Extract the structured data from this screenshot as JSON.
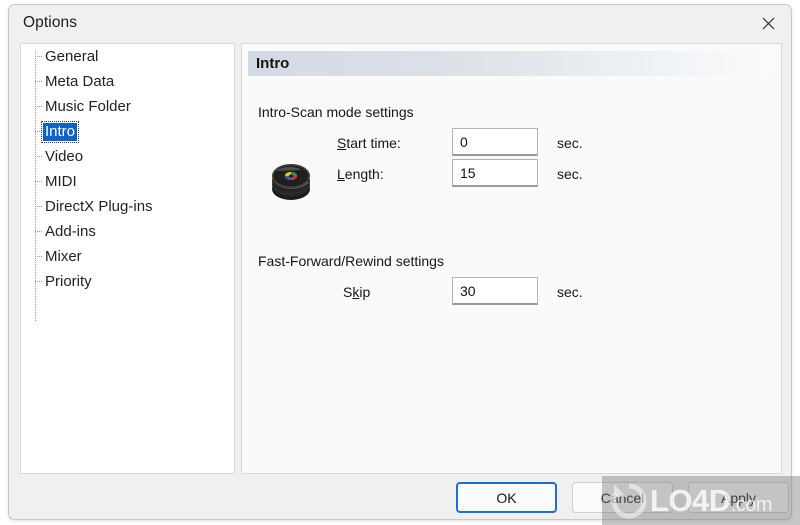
{
  "window": {
    "title": "Options",
    "close_icon": "close-icon"
  },
  "sidebar": {
    "items": [
      {
        "label": "General",
        "selected": false
      },
      {
        "label": "Meta Data",
        "selected": false
      },
      {
        "label": "Music Folder",
        "selected": false
      },
      {
        "label": "Intro",
        "selected": true
      },
      {
        "label": "Video",
        "selected": false
      },
      {
        "label": "MIDI",
        "selected": false
      },
      {
        "label": "DirectX Plug-ins",
        "selected": false
      },
      {
        "label": "Add-ins",
        "selected": false
      },
      {
        "label": "Mixer",
        "selected": false
      },
      {
        "label": "Priority",
        "selected": false
      }
    ],
    "selection_color": "#0f62c8"
  },
  "content": {
    "header": "Intro",
    "icon": "cd-stack-icon",
    "groups": [
      {
        "title": "Intro-Scan mode settings",
        "fields": [
          {
            "label_pre": "S",
            "label_accel": "",
            "label": "Start time:",
            "accel": "S",
            "value": "0",
            "unit": "sec."
          },
          {
            "label": "Length:",
            "accel": "L",
            "value": "15",
            "unit": "sec."
          }
        ]
      },
      {
        "title": "Fast-Forward/Rewind settings",
        "fields": [
          {
            "label": "Skip",
            "accel": "k",
            "value": "30",
            "unit": "sec."
          }
        ]
      }
    ],
    "labels": {
      "group1_title": "Intro-Scan mode settings",
      "group2_title": "Fast-Forward/Rewind settings",
      "start_time": "tart time:",
      "start_time_accel": "S",
      "length": "ength:",
      "length_accel": "L",
      "skip_pre": "S",
      "skip_accel": "k",
      "skip_post": "ip",
      "unit_sec": "sec."
    },
    "values": {
      "start_time": "0",
      "length": "15",
      "skip": "30"
    }
  },
  "buttons": {
    "ok": "OK",
    "cancel": "Cancel",
    "apply": "Apply"
  },
  "watermark": {
    "text": "LO4D",
    "suffix": ".com",
    "logo_icon": "refresh-circle-icon"
  }
}
